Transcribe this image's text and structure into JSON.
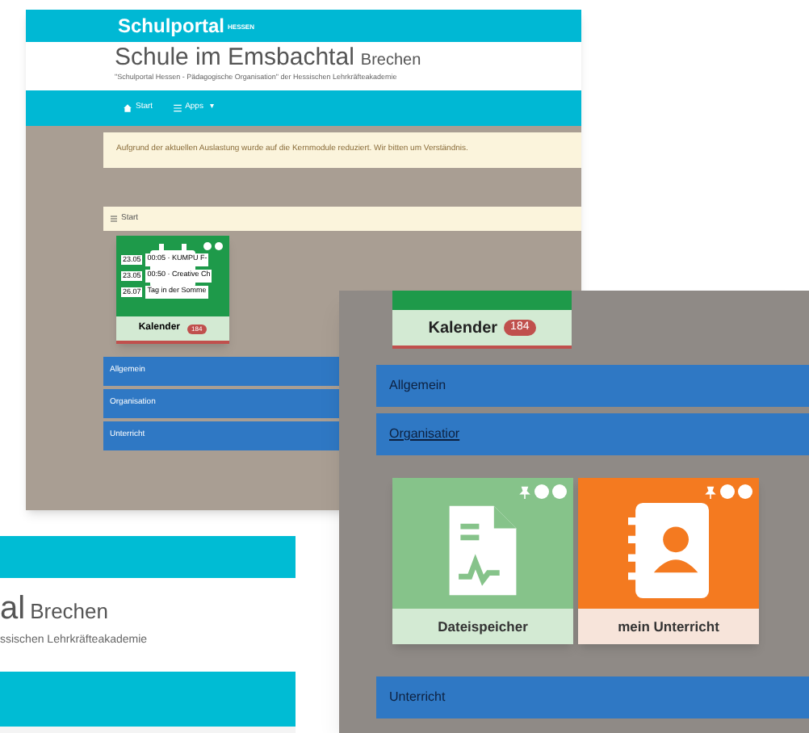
{
  "main_screenshot": {
    "brand": "Schulportal",
    "brand_sup": "HESSEN",
    "school": "Schule im Emsbachtal",
    "location": "Brechen",
    "subtitle": "\"Schulportal Hessen - Pädagogische Organisation\" der Hessischen Lehrkräfteakademie",
    "nav": [
      {
        "kind": "home",
        "label": "Start"
      },
      {
        "kind": "apps",
        "label": "Apps",
        "caret": "▾"
      }
    ],
    "notice": "Aufgrund der aktuellen Auslastung wurde auf die Kernmodule reduziert. Wir bitten um Verständnis.",
    "breadcrumb": "Start",
    "calendar_tile": {
      "label": "Kalender",
      "badge": "184",
      "events": [
        {
          "date": "23.05",
          "text": "00:05 · KUMPU F-"
        },
        {
          "date": "23.05",
          "text": "00:50 · Creative Ch"
        },
        {
          "date": "26.07",
          "text": "Tag in der Somme"
        }
      ]
    },
    "sections": [
      {
        "label": "Allgemein",
        "hovered": false
      },
      {
        "label": "Organisation",
        "hovered": false
      },
      {
        "label": "Unterricht",
        "hovered": false
      }
    ]
  },
  "detail_screenshot": {
    "calendar_tile": {
      "label": "Kalender",
      "badge": "184"
    },
    "sections": [
      {
        "label": "Allgemein",
        "hovered": false
      },
      {
        "label": "Organisatior",
        "hovered": true,
        "tiles": [
          {
            "kind": "files",
            "label": "Dateispeicher"
          },
          {
            "kind": "lessons",
            "label": "mein Unterricht"
          }
        ]
      },
      {
        "label": "Unterricht",
        "hovered": false
      }
    ]
  },
  "header_screenshot": {
    "title_fragment": "al",
    "location": "Brechen",
    "subtitle_fragment": "ssischen Lehrkräfteakademie"
  }
}
